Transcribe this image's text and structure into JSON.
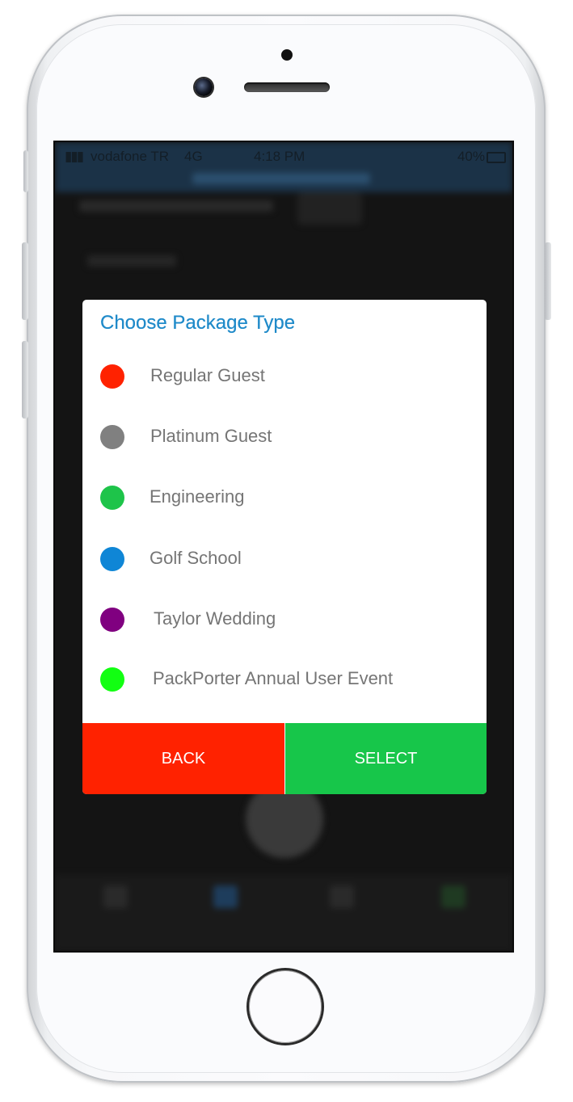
{
  "status_bar": {
    "signal": "▮▮▮",
    "carrier": "vodafone TR",
    "network": "4G",
    "time": "4:18 PM",
    "battery": "40%"
  },
  "dialog": {
    "title": "Choose Package Type",
    "options": [
      {
        "label": "Regular Guest",
        "color": "#ff2200"
      },
      {
        "label": "Platinum Guest",
        "color": "#808080"
      },
      {
        "label": "Engineering",
        "color": "#1ec44a"
      },
      {
        "label": "Golf School",
        "color": "#0f86d6"
      },
      {
        "label": "Taylor Wedding",
        "color": "#800080"
      },
      {
        "label": "PackPorter Annual User Event",
        "color": "#12ff12"
      }
    ],
    "back_label": "BACK",
    "select_label": "SELECT",
    "back_color": "#ff2200",
    "select_color": "#17c64a"
  }
}
